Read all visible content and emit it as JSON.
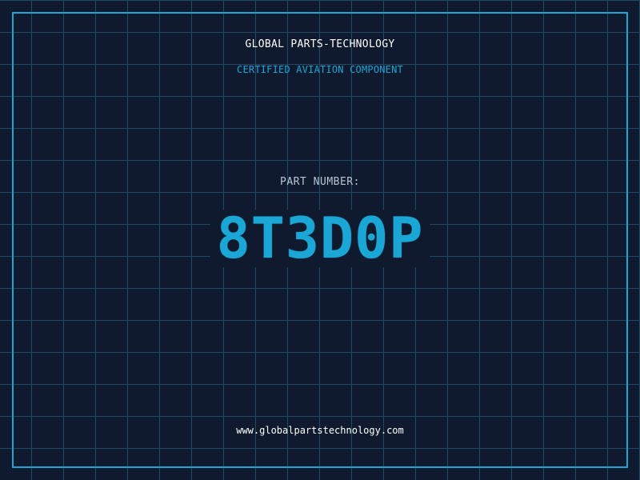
{
  "header": {
    "company": "GLOBAL PARTS-TECHNOLOGY",
    "subtitle": "CERTIFIED AVIATION COMPONENT"
  },
  "part": {
    "label": "PART NUMBER:",
    "number": "8T3D0P"
  },
  "footer": {
    "url": "www.globalpartstechnology.com"
  },
  "colors": {
    "background": "#0f1a2e",
    "grid": "#1f4a66",
    "accent": "#1ba7d6",
    "text": "#ffffff"
  }
}
